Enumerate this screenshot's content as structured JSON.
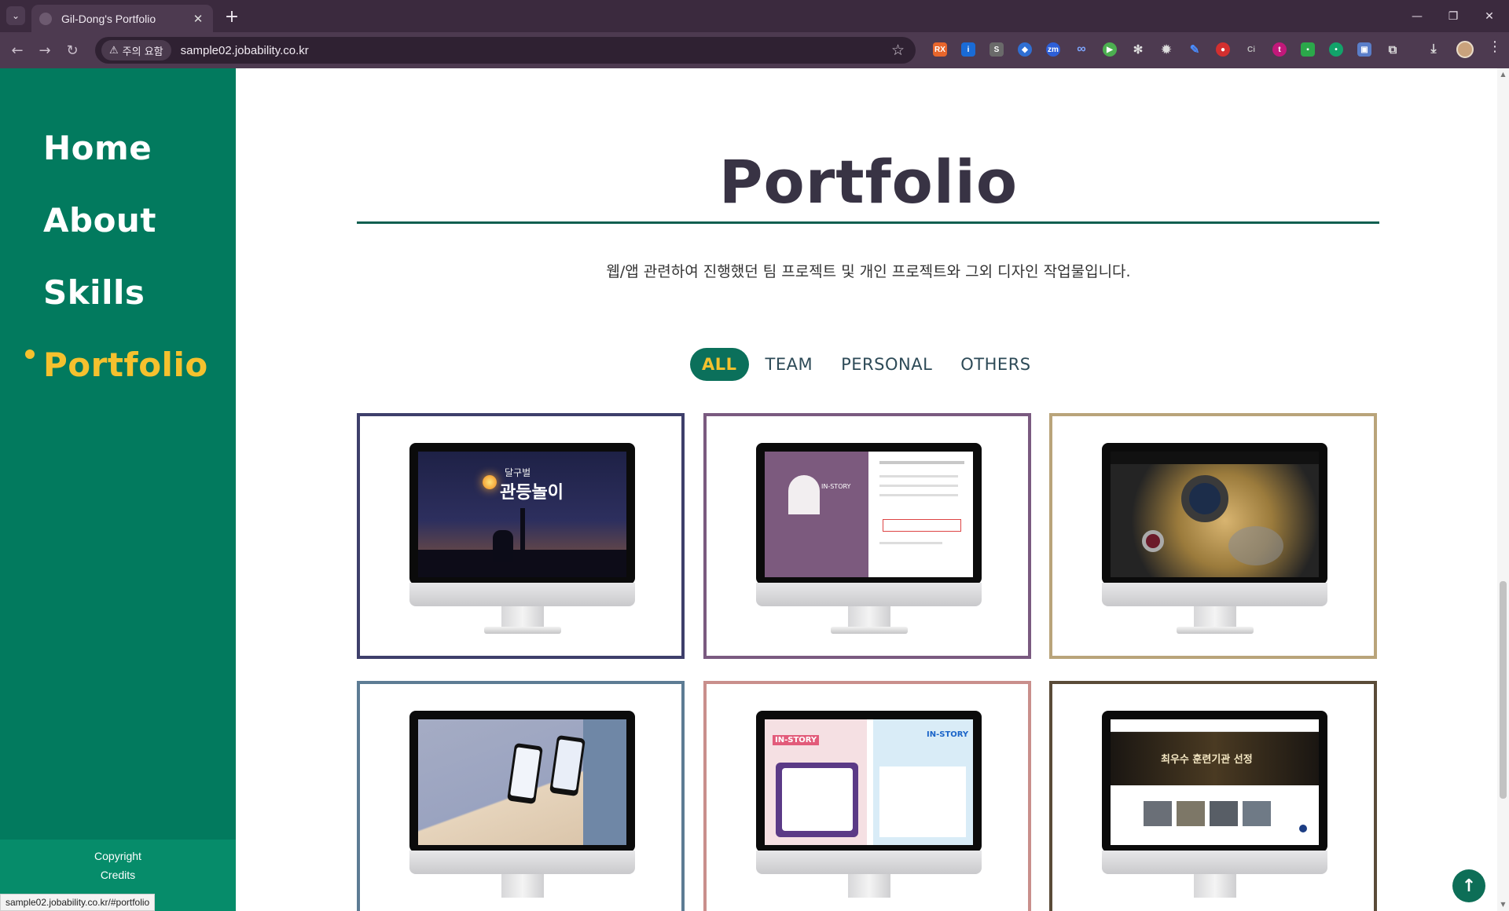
{
  "browser": {
    "tab_title": "Gil-Dong's Portfolio",
    "tab_close": "✕",
    "new_tab": "+",
    "security_label": "주의 요함",
    "url": "sample02.jobability.co.kr",
    "status_url": "sample02.jobability.co.kr/#portfolio"
  },
  "sidebar": {
    "items": [
      {
        "label": "Home"
      },
      {
        "label": "About"
      },
      {
        "label": "Skills"
      },
      {
        "label": "Portfolio",
        "active": true
      }
    ],
    "footer": {
      "copyright": "Copyright",
      "credits": "Credits"
    }
  },
  "portfolio": {
    "title": "Portfolio",
    "subtitle": "웹/앱 관련하여 진행했던 팀 프로젝트 및 개인 프로젝트와 그외 디자인 작업물입니다.",
    "filters": [
      {
        "label": "ALL",
        "active": true
      },
      {
        "label": "TEAM"
      },
      {
        "label": "PERSONAL"
      },
      {
        "label": "OTHERS"
      }
    ],
    "cards": [
      {
        "border_color": "#3e3f6b",
        "screen": {
          "headline": "관등놀이",
          "kicker": "달구벌"
        }
      },
      {
        "border_color": "#7a5a80",
        "screen": {
          "headline": "IN-STORY",
          "kicker": ""
        }
      },
      {
        "border_color": "#b9a47a",
        "screen": {
          "headline": "",
          "kicker": ""
        }
      },
      {
        "border_color": "#5d7c94",
        "screen": {
          "headline": "",
          "kicker": ""
        }
      },
      {
        "border_color": "#c98f8c",
        "screen": {
          "headline": "IN-STORY",
          "kicker": "IN-STORY"
        }
      },
      {
        "border_color": "#5a4b38",
        "screen": {
          "headline": "최우수 훈련기관 선정",
          "kicker": ""
        }
      }
    ]
  },
  "colors": {
    "sidebar_bg": "#027a5e",
    "accent": "#f5c12e",
    "title_text": "#383344"
  },
  "icons": {
    "back": "arrow-left-icon",
    "forward": "arrow-right-icon",
    "reload": "reload-icon",
    "warning": "warning-icon",
    "star": "star-icon",
    "scroll_top": "arrow-up-icon"
  }
}
